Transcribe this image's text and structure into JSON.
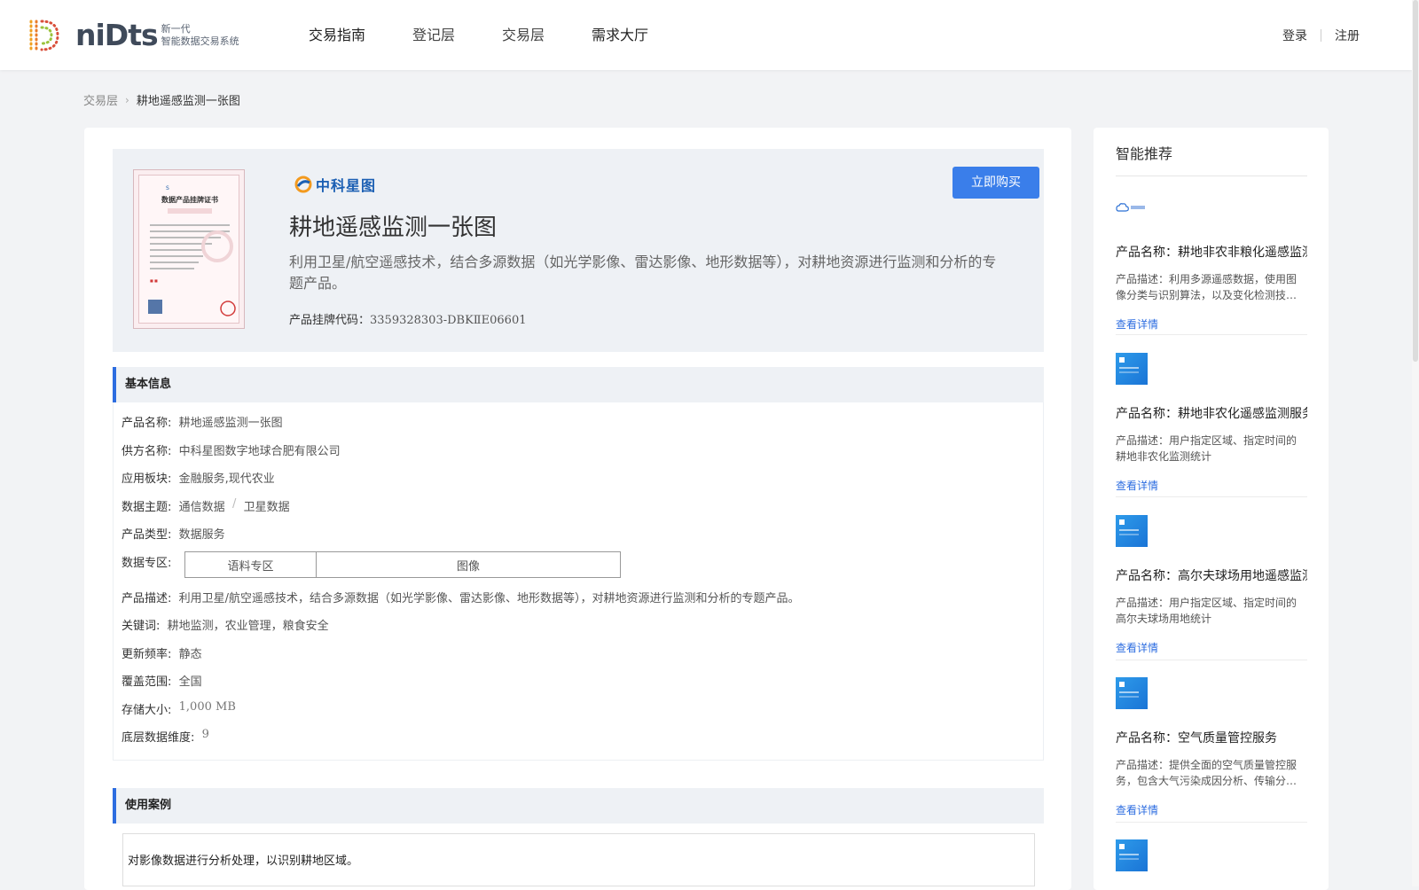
{
  "header": {
    "logo_word": "niDts",
    "logo_sub_line1": "新一代",
    "logo_sub_line2": "智能数据交易系统",
    "nav": [
      "交易指南",
      "登记层",
      "交易层",
      "需求大厅"
    ],
    "login": "登录",
    "register": "注册"
  },
  "breadcrumb": {
    "parent": "交易层",
    "current": "耕地遥感监测一张图"
  },
  "hero": {
    "brand": "中科星图",
    "title": "耕地遥感监测一张图",
    "description": "利用卫星/航空遥感技术，结合多源数据（如光学影像、雷达影像、地形数据等），对耕地资源进行监测和分析的专题产品。",
    "listing_label": "产品挂牌代码：",
    "listing_code": "3359328303-DBKⅡE06601",
    "buy_button": "立即购买",
    "certificate_title": "数据产品挂牌证书"
  },
  "basic_info": {
    "heading": "基本信息",
    "product_name_label": "产品名称:",
    "product_name": "耕地遥感监测一张图",
    "supplier_label": "供方名称:",
    "supplier": "中科星图数字地球合肥有限公司",
    "sector_label": "应用板块:",
    "sector": "金融服务,现代农业",
    "theme_label": "数据主题:",
    "theme_1": "通信数据",
    "theme_sep": "/",
    "theme_2": "卫星数据",
    "type_label": "产品类型:",
    "type": "数据服务",
    "zone_label": "数据专区:",
    "zones": [
      "语料专区",
      "图像"
    ],
    "desc_label": "产品描述:",
    "desc": "利用卫星/航空遥感技术，结合多源数据（如光学影像、雷达影像、地形数据等），对耕地资源进行监测和分析的专题产品。",
    "keywords_label": "关键词:",
    "keywords": "耕地监测，农业管理，粮食安全",
    "frequency_label": "更新频率:",
    "frequency": "静态",
    "coverage_label": "覆盖范围:",
    "coverage": "全国",
    "storage_label": "存储大小:",
    "storage": "1,000 MB",
    "dimension_label": "底层数据维度:",
    "dimension": "9"
  },
  "use_case": {
    "heading": "使用案例",
    "text": "对影像数据进行分析处理，以识别耕地区域。"
  },
  "sidebar": {
    "title": "智能推荐",
    "link_label": "查看详情",
    "items": [
      {
        "name": "产品名称：耕地非农非粮化遥感监测",
        "desc": "产品描述：利用多源遥感数据，使用图像分类与识别算法，以及变化检测技…",
        "thumb": "logo"
      },
      {
        "name": "产品名称：耕地非农化遥感监测服务",
        "desc": "产品描述：用户指定区域、指定时间的耕地非农化监测统计",
        "thumb": "blue"
      },
      {
        "name": "产品名称：高尔夫球场用地遥感监测",
        "desc": "产品描述：用户指定区域、指定时间的高尔夫球场用地统计",
        "thumb": "blue"
      },
      {
        "name": "产品名称：空气质量管控服务",
        "desc": "产品描述：提供全面的空气质量管控服务，包含大气污染成因分析、传输分…",
        "thumb": "blue"
      }
    ]
  },
  "colors": {
    "accent": "#3a7eea",
    "section_bar": "#2d6de0",
    "link": "#2d6de0"
  }
}
